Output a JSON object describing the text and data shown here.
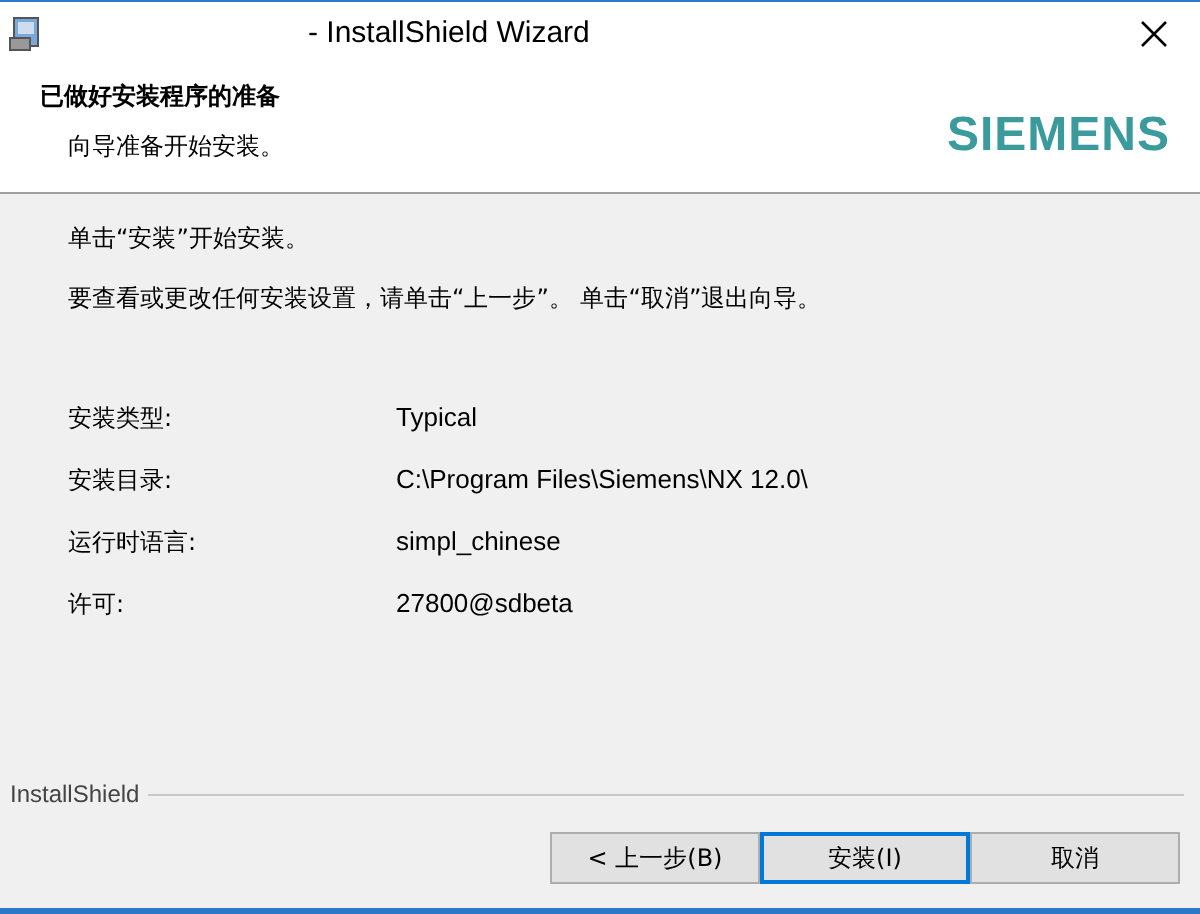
{
  "window": {
    "title": "- InstallShield Wizard"
  },
  "header": {
    "title": "已做好安装程序的准备",
    "subtitle": "向导准备开始安装。",
    "logo": "SIEMENS"
  },
  "body": {
    "paragraphs": [
      "单击“安装”开始安装。",
      "要查看或更改任何安装设置，请单击“上一步”。 单击“取消”退出向导。"
    ],
    "settings": [
      {
        "label": "安装类型:",
        "value": "Typical"
      },
      {
        "label": "安装目录:",
        "value": "C:\\Program Files\\Siemens\\NX 12.0\\"
      },
      {
        "label": "运行时语言:",
        "value": "simpl_chinese"
      },
      {
        "label": "许可:",
        "value": "27800@sdbeta"
      }
    ]
  },
  "footer": {
    "brand": "InstallShield"
  },
  "buttons": [
    {
      "label": "< 上一步(B)",
      "focused": false
    },
    {
      "label": "安装(I)",
      "focused": true
    },
    {
      "label": "取消",
      "focused": false
    }
  ]
}
